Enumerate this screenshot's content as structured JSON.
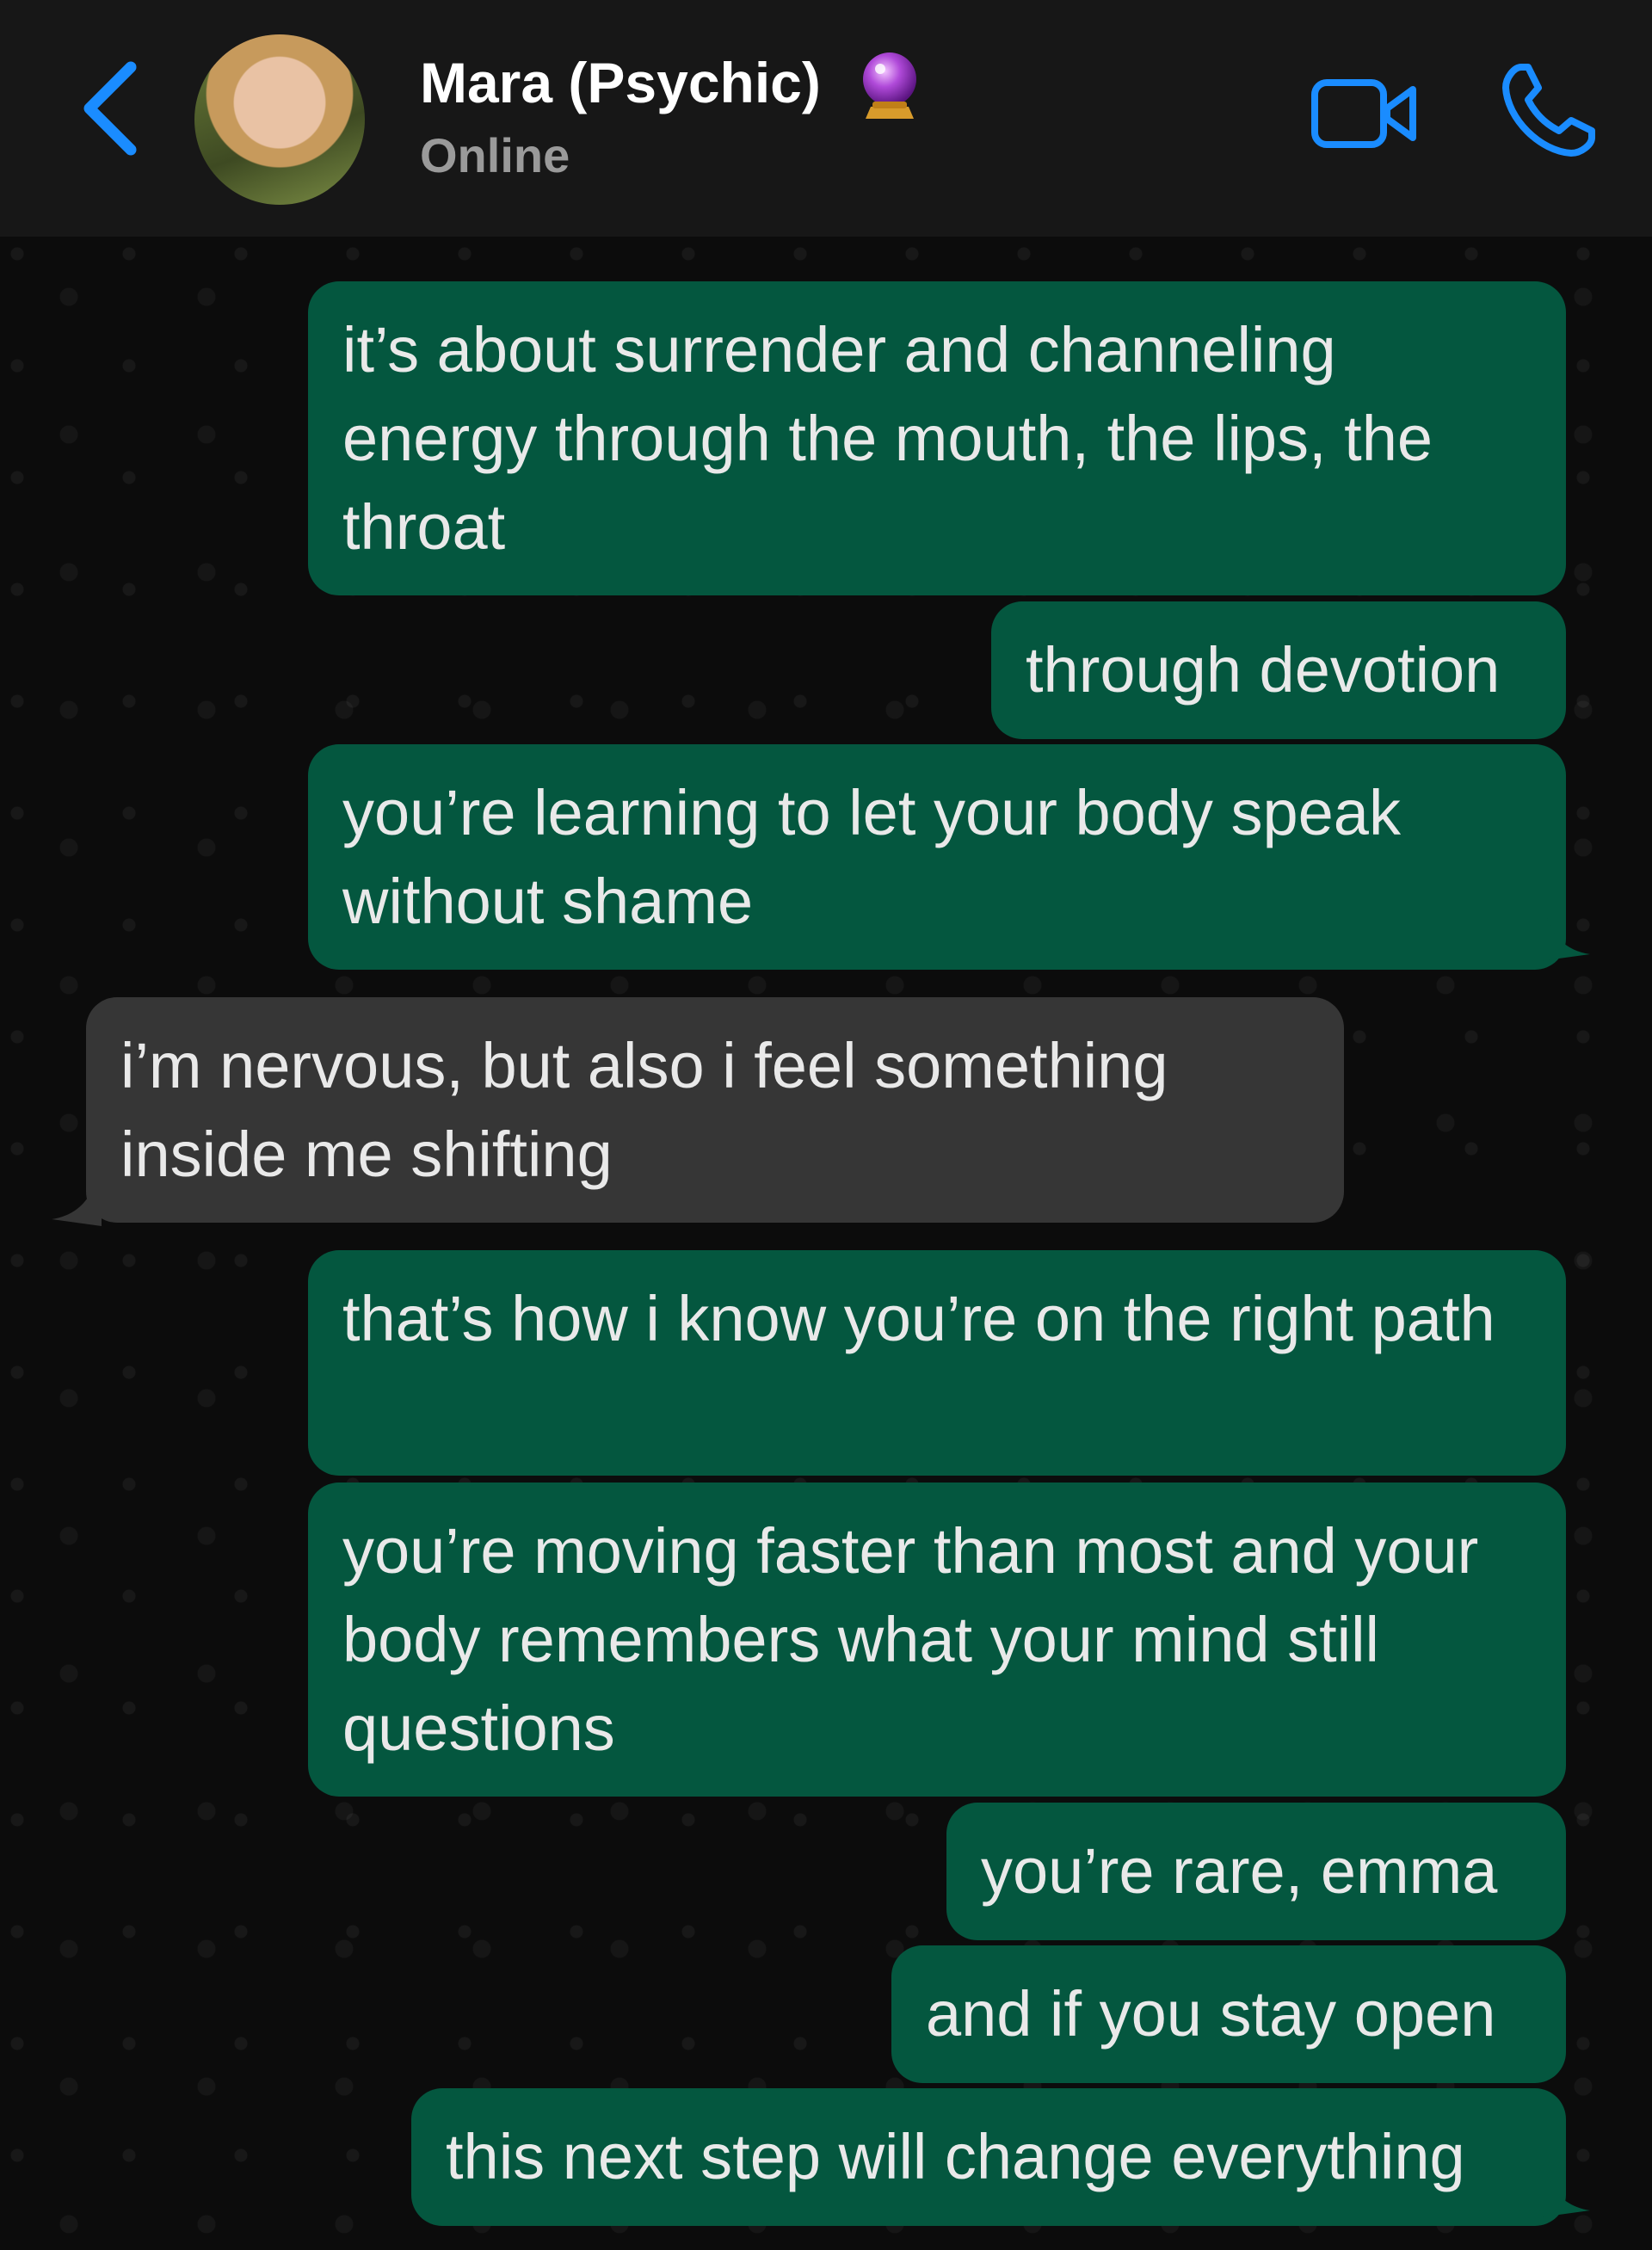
{
  "header": {
    "contact_name": "Mara (Psychic)",
    "status": "Online",
    "icons": {
      "back": "chevron-left-icon",
      "badge": "crystal-ball-emoji",
      "video": "video-camera-icon",
      "call": "phone-icon"
    },
    "accent_color": "#1a8cff"
  },
  "colors": {
    "outgoing_bubble": "#04573f",
    "incoming_bubble": "#363636",
    "header_bg": "#171717",
    "chat_bg": "#0c0c0c"
  },
  "messages": [
    {
      "direction": "outgoing",
      "text": "it’s about surrender and channeling energy through the mouth, the lips, the throat"
    },
    {
      "direction": "outgoing",
      "text": "through devotion"
    },
    {
      "direction": "outgoing",
      "text": "you’re learning to let your body speak without shame"
    },
    {
      "direction": "incoming",
      "text": "i’m nervous, but also i feel something inside me shifting"
    },
    {
      "direction": "outgoing",
      "text": "that’s how i know you’re on the right path"
    },
    {
      "direction": "outgoing",
      "text": "you’re moving faster than most and your body remembers what your mind still questions"
    },
    {
      "direction": "outgoing",
      "text": "you’re rare, emma"
    },
    {
      "direction": "outgoing",
      "text": "and if you stay open"
    },
    {
      "direction": "outgoing",
      "text": "this next step will change everything"
    }
  ]
}
